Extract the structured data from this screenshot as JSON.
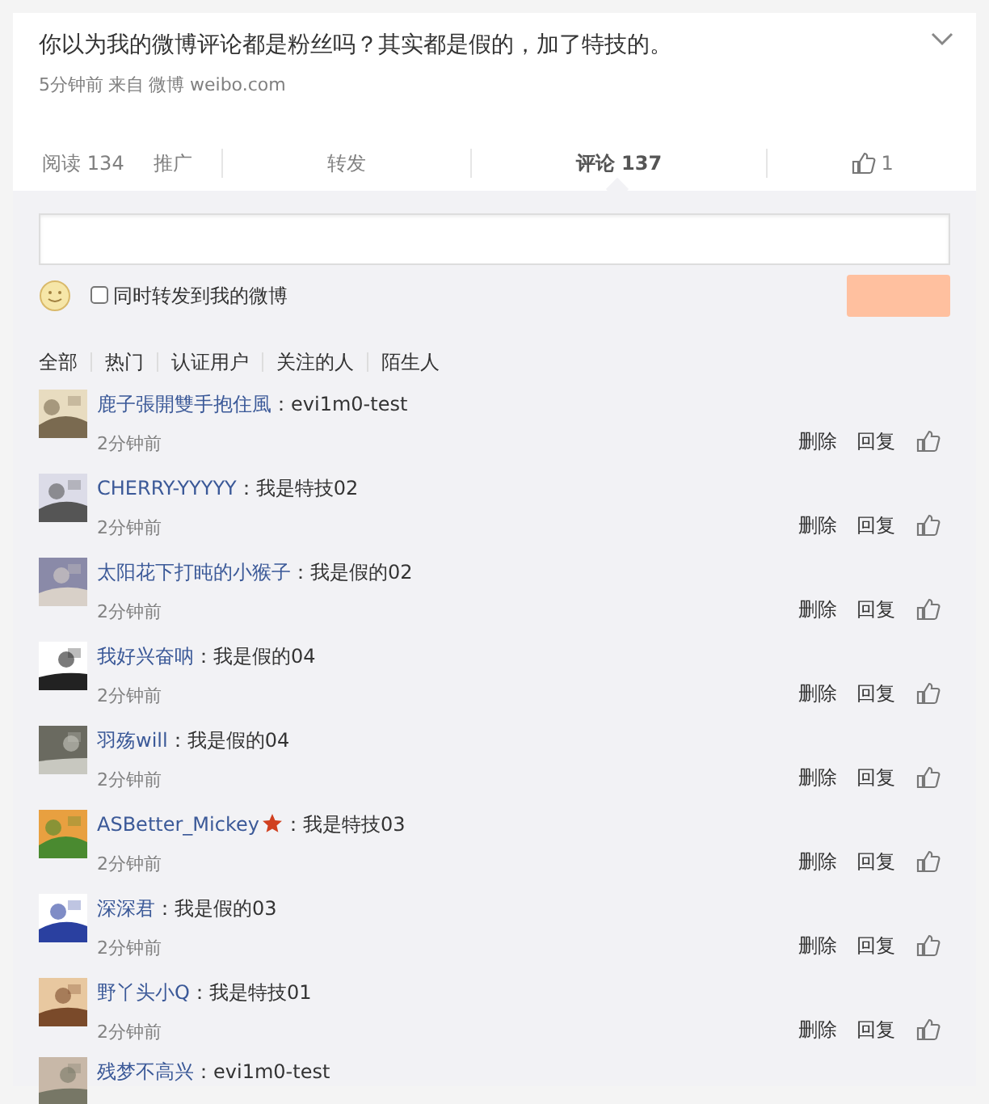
{
  "post": {
    "text": "你以为我的微博评论都是粉丝吗？其实都是假的，加了特技的。",
    "time": "5分钟前",
    "source_label": "来自",
    "source": "微博 weibo.com"
  },
  "stats": [
    {
      "label": "阅读 134",
      "kind": "text",
      "selected": false
    },
    {
      "label": "推广",
      "kind": "link",
      "selected": false
    },
    {
      "label": "转发",
      "kind": "tab",
      "selected": false
    },
    {
      "label": "评论 137",
      "kind": "tab",
      "selected": true
    },
    {
      "label": "1",
      "kind": "like",
      "selected": false
    }
  ],
  "composer": {
    "repost_label": "同时转发到我的微博",
    "repost_checked": false
  },
  "filters": [
    {
      "label": "全部"
    },
    {
      "label": "热门"
    },
    {
      "label": "认证用户"
    },
    {
      "label": "关注的人"
    },
    {
      "label": "陌生人"
    }
  ],
  "comments": [
    {
      "name": "鹿子張開雙手抱住風",
      "text": "：evi1m0-test",
      "time": "2分钟前",
      "delete": "删除",
      "reply": "回复",
      "badge": false
    },
    {
      "name": "CHERRY-YYYYY",
      "text": "：我是特技02",
      "time": "2分钟前",
      "delete": "删除",
      "reply": "回复",
      "badge": false
    },
    {
      "name": "太阳花下打盹的小猴子",
      "text": "：我是假的02",
      "time": "2分钟前",
      "delete": "删除",
      "reply": "回复",
      "badge": false
    },
    {
      "name": "我好兴奋呐",
      "text": "：我是假的04",
      "time": "2分钟前",
      "delete": "删除",
      "reply": "回复",
      "badge": false
    },
    {
      "name": "羽殇will",
      "text": "：我是假的04",
      "time": "2分钟前",
      "delete": "删除",
      "reply": "回复",
      "badge": false
    },
    {
      "name": "ASBetter_Mickey",
      "text": "：我是特技03",
      "time": "2分钟前",
      "delete": "删除",
      "reply": "回复",
      "badge": true
    },
    {
      "name": "深深君",
      "text": "：我是假的03",
      "time": "2分钟前",
      "delete": "删除",
      "reply": "回复",
      "badge": false
    },
    {
      "name": "野丫头小Q",
      "text": "：我是特技01",
      "time": "2分钟前",
      "delete": "删除",
      "reply": "回复",
      "badge": false
    },
    {
      "name": "残梦不高兴",
      "text": "：evi1m0-test",
      "badge": false
    }
  ]
}
